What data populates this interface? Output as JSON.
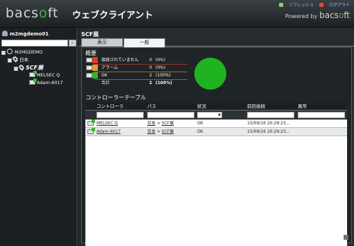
{
  "header": {
    "logo_left": "bacs",
    "logo_o": "o",
    "logo_right": "ft",
    "app_title": "ウェブクライアント",
    "powered_by": "Powered by",
    "powered_logo_left": "bacs",
    "powered_logo_o": "o",
    "powered_logo_right": "ft",
    "link_refresh": "リフレッシュ",
    "link_logout": "ログアウト"
  },
  "sidebar": {
    "username": "m2mgdemo01",
    "search_value": "",
    "tree": {
      "root": "M2MGDEMO",
      "region": "日本",
      "site": "SCF展",
      "devices": [
        "MELSEC Q",
        "Adam-6017"
      ]
    }
  },
  "main": {
    "title": "SCF展",
    "tabs": [
      "表示",
      "一般"
    ],
    "summary_title": "概要",
    "summary": [
      {
        "label": "接続されていません",
        "count": "0",
        "pct": "(0%)",
        "color": "#e03a2a"
      },
      {
        "label": "アラーム",
        "count": "0",
        "pct": "(0%)",
        "color": "#e59a2a"
      },
      {
        "label": "OK",
        "count": "2",
        "pct": "(100%)",
        "color": "#2fb52f"
      },
      {
        "label": "合計",
        "count": "2",
        "pct": "(100%)",
        "color": ""
      }
    ],
    "table_title": "コントローラーテーブル",
    "columns": [
      "コントローラ",
      "パス",
      "状況",
      "前回接続",
      "異常"
    ],
    "rows": [
      {
        "name": "MELSEC Q",
        "path_a": "日本",
        "sep": ">",
        "path_b": "SCF展",
        "status": "OK",
        "last": "15/09/16 20:29:23..."
      },
      {
        "name": "Adam-6017",
        "path_a": "日本",
        "sep": ">",
        "path_b": "SCF展",
        "status": "OK",
        "last": "15/09/16 20:29:23..."
      }
    ]
  },
  "colors": {
    "accent_green": "#1fb31f",
    "alarm": "#e59a2a",
    "error": "#e03a2a"
  }
}
